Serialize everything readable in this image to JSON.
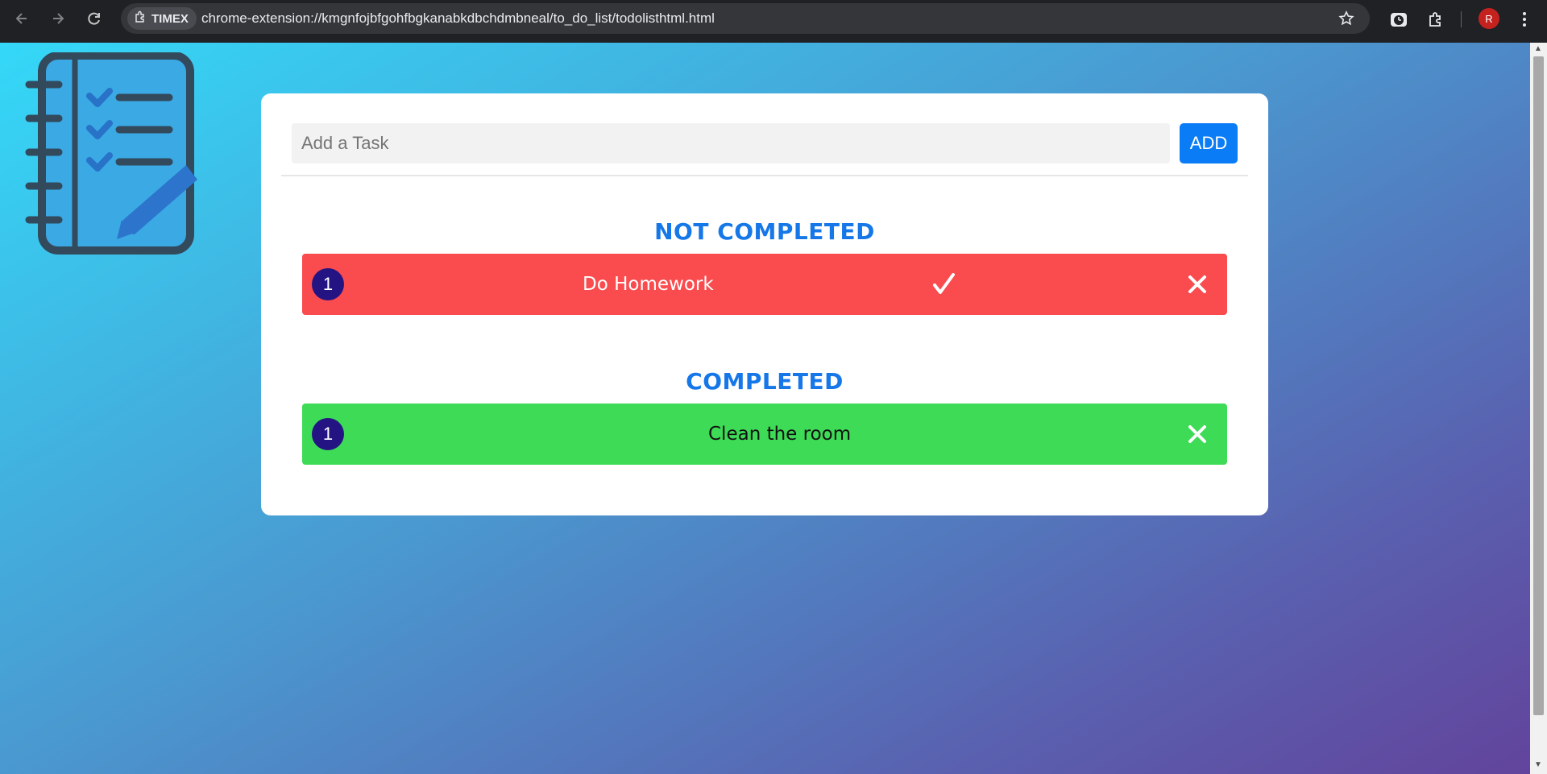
{
  "browser": {
    "extension_chip": "TIMEX",
    "url": "chrome-extension://kmgnfojbfgohfbgkanabkdbchdmbneal/to_do_list/todolisthtml.html",
    "avatar_letter": "R",
    "icons": [
      "back-icon",
      "forward-icon",
      "reload-icon",
      "star-icon",
      "timer-icon",
      "puzzle-icon",
      "more-icon"
    ]
  },
  "app": {
    "logo_icon": "checklist-notebook-icon",
    "input": {
      "placeholder": "Add a Task",
      "value": ""
    },
    "add_button": "ADD",
    "not_completed": {
      "title": "NOT COMPLETED",
      "tasks": [
        {
          "number": "1",
          "text": "Do Homework"
        }
      ]
    },
    "completed": {
      "title": "COMPLETED",
      "tasks": [
        {
          "number": "1",
          "text": "Clean the room"
        }
      ]
    }
  },
  "colors": {
    "accent_blue": "#0a7cf5",
    "title_blue": "#1577e8",
    "not_completed_row": "#fa4b4e",
    "completed_row": "#3edb56",
    "badge": "#241483"
  }
}
